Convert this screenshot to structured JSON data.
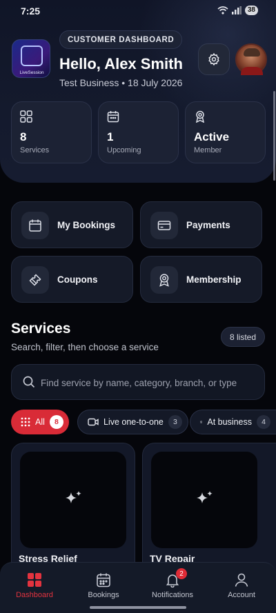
{
  "status_bar": {
    "time": "7:25",
    "battery": "38"
  },
  "header": {
    "app_logo_text": "LiveSession",
    "badge_label": "CUSTOMER DASHBOARD",
    "greeting": "Hello, Alex Smith",
    "business_line": "Test Business • 18 July 2026"
  },
  "stats": [
    {
      "icon": "grid-icon",
      "value": "8",
      "label": "Services"
    },
    {
      "icon": "calendar-icon",
      "value": "1",
      "label": "Upcoming"
    },
    {
      "icon": "award-icon",
      "value": "Active",
      "label": "Member"
    }
  ],
  "quick_actions": [
    {
      "icon": "calendar-icon",
      "label": "My Bookings"
    },
    {
      "icon": "card-icon",
      "label": "Payments"
    },
    {
      "icon": "ticket-icon",
      "label": "Coupons"
    },
    {
      "icon": "award-icon",
      "label": "Membership"
    }
  ],
  "services": {
    "title": "Services",
    "subtitle": "Search, filter, then choose a service",
    "count_badge": "8 listed",
    "search_placeholder": "Find service by name, category, branch, or type",
    "filters": [
      {
        "icon": "grid-dots-icon",
        "label": "All",
        "count": "8",
        "active": true
      },
      {
        "icon": "video-icon",
        "label": "Live one-to-one",
        "count": "3",
        "active": false
      },
      {
        "icon": "store-icon",
        "label": "At business",
        "count": "4",
        "active": false
      }
    ],
    "cards": [
      {
        "name": "Stress Relief",
        "icon": "sparkles-icon"
      },
      {
        "name": "TV Repair",
        "icon": "sparkles-icon"
      }
    ]
  },
  "bottom_nav": [
    {
      "icon": "dashboard-icon",
      "label": "Dashboard",
      "active": true
    },
    {
      "icon": "calendar-icon",
      "label": "Bookings",
      "active": false
    },
    {
      "icon": "bell-icon",
      "label": "Notifications",
      "badge": "2",
      "active": false
    },
    {
      "icon": "user-icon",
      "label": "Account",
      "active": false
    }
  ],
  "colors": {
    "accent": "#d92b37",
    "background": "#05060b",
    "card": "#1c2234"
  }
}
